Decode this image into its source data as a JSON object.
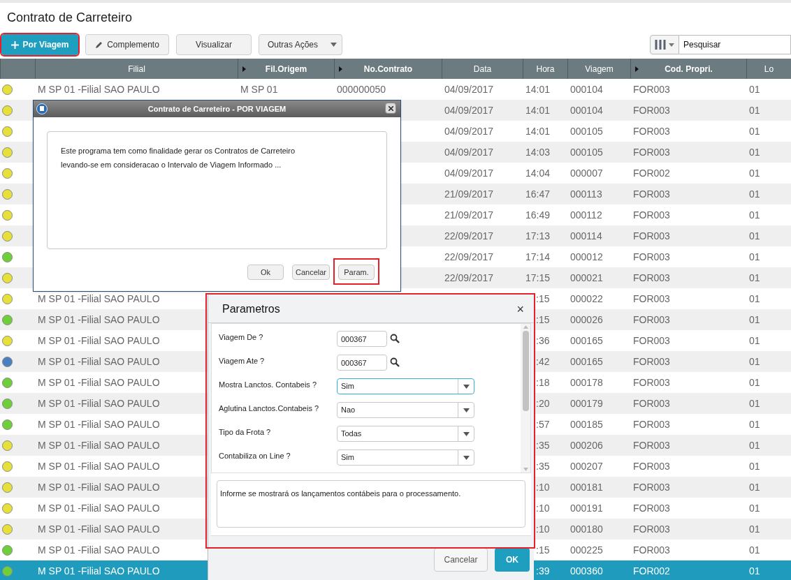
{
  "page": {
    "title": "Contrato de Carreteiro"
  },
  "toolbar": {
    "buttons": [
      {
        "label": "Por Viagem",
        "kind": "primary",
        "highlighted": true
      },
      {
        "label": "Complemento",
        "kind": "edit",
        "highlighted": false
      },
      {
        "label": "Visualizar",
        "kind": "plain",
        "highlighted": false
      },
      {
        "label": "Outras Ações",
        "kind": "dropdown",
        "highlighted": false
      }
    ],
    "search": {
      "placeholder": "Pesquisar"
    }
  },
  "table": {
    "columns": [
      {
        "arrow": false
      },
      {
        "label": "Filial",
        "arrow": false
      },
      {
        "label": "Fil.Origem",
        "arrow": true
      },
      {
        "label": "No.Contrato",
        "arrow": true
      },
      {
        "label": "Data",
        "arrow": false
      },
      {
        "label": "Hora",
        "arrow": false
      },
      {
        "label": "Viagem",
        "arrow": false
      },
      {
        "label": "Cod. Propri.",
        "arrow": true
      },
      {
        "label": "Lo",
        "arrow": false
      }
    ],
    "rows": [
      {
        "color": "#e8e03a",
        "selected": false,
        "filial": "M SP 01 -Filial SAO PAULO",
        "fil_origem": "M SP 01",
        "no_contrato": "000000050",
        "data": "04/09/2017",
        "hora": "14:01",
        "viagem": "000104",
        "cod_propri": "FOR003",
        "column_9": "01"
      },
      {
        "color": "#e8e03a",
        "selected": false,
        "data": "04/09/2017",
        "hora": "14:01",
        "viagem": "000104",
        "cod_propri": "FOR003",
        "column_9": "01"
      },
      {
        "color": "#e8e03a",
        "selected": false,
        "data": "04/09/2017",
        "hora": "14:01",
        "viagem": "000105",
        "cod_propri": "FOR003",
        "column_9": "01"
      },
      {
        "color": "#e8e03a",
        "selected": false,
        "data": "04/09/2017",
        "hora": "14:03",
        "viagem": "000105",
        "cod_propri": "FOR003",
        "column_9": "01"
      },
      {
        "color": "#e8e03a",
        "selected": false,
        "data": "04/09/2017",
        "hora": "14:04",
        "viagem": "000007",
        "cod_propri": "FOR002",
        "column_9": "01"
      },
      {
        "color": "#e8e03a",
        "selected": false,
        "data": "21/09/2017",
        "hora": "16:47",
        "viagem": "000113",
        "cod_propri": "FOR003",
        "column_9": "01"
      },
      {
        "color": "#e8e03a",
        "selected": false,
        "data": "21/09/2017",
        "hora": "16:49",
        "viagem": "000112",
        "cod_propri": "FOR003",
        "column_9": "01"
      },
      {
        "color": "#e8e03a",
        "selected": false,
        "data": "22/09/2017",
        "hora": "17:13",
        "viagem": "000114",
        "cod_propri": "FOR003",
        "column_9": "01"
      },
      {
        "color": "#6fcf3a",
        "selected": false,
        "data": "22/09/2017",
        "hora": "17:14",
        "viagem": "000012",
        "cod_propri": "FOR003",
        "column_9": "01"
      },
      {
        "color": "#e8e03a",
        "selected": false,
        "data": "22/09/2017",
        "hora": "17:15",
        "viagem": "000021",
        "cod_propri": "FOR003",
        "column_9": "01"
      },
      {
        "color": "#e8e03a",
        "selected": false,
        "filial": "M SP 01 -Filial SAO PAULO",
        "hora": ":15",
        "viagem": "000022",
        "cod_propri": "FOR003",
        "column_9": "01"
      },
      {
        "color": "#6fcf3a",
        "selected": false,
        "filial": "M SP 01 -Filial SAO PAULO",
        "hora": ":15",
        "viagem": "000026",
        "cod_propri": "FOR003",
        "column_9": "01"
      },
      {
        "color": "#e8e03a",
        "selected": false,
        "filial": "M SP 01 -Filial SAO PAULO",
        "hora": ":36",
        "viagem": "000165",
        "cod_propri": "FOR003",
        "column_9": "01"
      },
      {
        "color": "#4a7fc0",
        "selected": false,
        "filial": "M SP 01 -Filial SAO PAULO",
        "hora": ":42",
        "viagem": "000165",
        "cod_propri": "FOR003",
        "column_9": "01"
      },
      {
        "color": "#6fcf3a",
        "selected": false,
        "filial": "M SP 01 -Filial SAO PAULO",
        "hora": ":18",
        "viagem": "000178",
        "cod_propri": "FOR003",
        "column_9": "01"
      },
      {
        "color": "#6fcf3a",
        "selected": false,
        "filial": "M SP 01 -Filial SAO PAULO",
        "hora": ":20",
        "viagem": "000179",
        "cod_propri": "FOR003",
        "column_9": "01"
      },
      {
        "color": "#6fcf3a",
        "selected": false,
        "filial": "M SP 01 -Filial SAO PAULO",
        "hora": ":57",
        "viagem": "000185",
        "cod_propri": "FOR003",
        "column_9": "01"
      },
      {
        "color": "#e8e03a",
        "selected": false,
        "filial": "M SP 01 -Filial SAO PAULO",
        "hora": ":35",
        "viagem": "000206",
        "cod_propri": "FOR003",
        "column_9": "01"
      },
      {
        "color": "#e8e03a",
        "selected": false,
        "filial": "M SP 01 -Filial SAO PAULO",
        "hora": ":35",
        "viagem": "000207",
        "cod_propri": "FOR003",
        "column_9": "01"
      },
      {
        "color": "#e8e03a",
        "selected": false,
        "filial": "M SP 01 -Filial SAO PAULO",
        "hora": ":10",
        "viagem": "000181",
        "cod_propri": "FOR003",
        "column_9": "01"
      },
      {
        "color": "#e8e03a",
        "selected": false,
        "filial": "M SP 01 -Filial SAO PAULO",
        "hora": ":10",
        "viagem": "000191",
        "cod_propri": "FOR003",
        "column_9": "01"
      },
      {
        "color": "#e8e03a",
        "selected": false,
        "filial": "M SP 01 -Filial SAO PAULO",
        "hora": ":10",
        "viagem": "000180",
        "cod_propri": "FOR003",
        "column_9": "01"
      },
      {
        "color": "#6fcf3a",
        "selected": false,
        "filial": "M SP 01 -Filial SAO PAULO",
        "hora": ":15",
        "viagem": "000225",
        "cod_propri": "FOR003",
        "column_9": "01"
      },
      {
        "color": "#6fcf3a",
        "selected": true,
        "filial": "M SP 01 -Filial SAO PAULO",
        "hora": ":39",
        "viagem": "000360",
        "cod_propri": "FOR002",
        "column_9": "01"
      }
    ]
  },
  "process_dialog": {
    "title": "Contrato de Carreteiro - POR VIAGEM",
    "lines": [
      "Este programa tem como finalidade gerar os Contratos de Carreteiro",
      "levando-se em consideracao o Intervalo de Viagem Informado ..."
    ],
    "buttons": [
      {
        "label": "Ok",
        "highlighted": false
      },
      {
        "label": "Cancelar",
        "highlighted": false
      },
      {
        "label": "Param.",
        "highlighted": true
      }
    ]
  },
  "params_dialog": {
    "title": "Parametros",
    "close": "×",
    "highlighted": true,
    "fields": [
      {
        "label": "Viagem De ?",
        "kind": "lookup",
        "value": "000367",
        "focused": false
      },
      {
        "label": "Viagem Ate ?",
        "kind": "lookup",
        "value": "000367",
        "focused": false
      },
      {
        "label": "Mostra Lanctos. Contabeis ?",
        "kind": "select",
        "value": "Sim",
        "focused": true
      },
      {
        "label": "Aglutina Lanctos.Contabeis ?",
        "kind": "select",
        "value": "Nao",
        "focused": false
      },
      {
        "label": "Tipo da Frota ?",
        "kind": "select",
        "value": "Todas",
        "focused": false
      },
      {
        "label": "Contabiliza on Line ?",
        "kind": "select",
        "value": "Sim",
        "focused": false
      }
    ],
    "help": "Informe se mostrará os lançamentos contábeis para o processamento.",
    "buttons": [
      {
        "label": "Cancelar",
        "kind": "secondary"
      },
      {
        "label": "OK",
        "kind": "primary"
      }
    ]
  }
}
